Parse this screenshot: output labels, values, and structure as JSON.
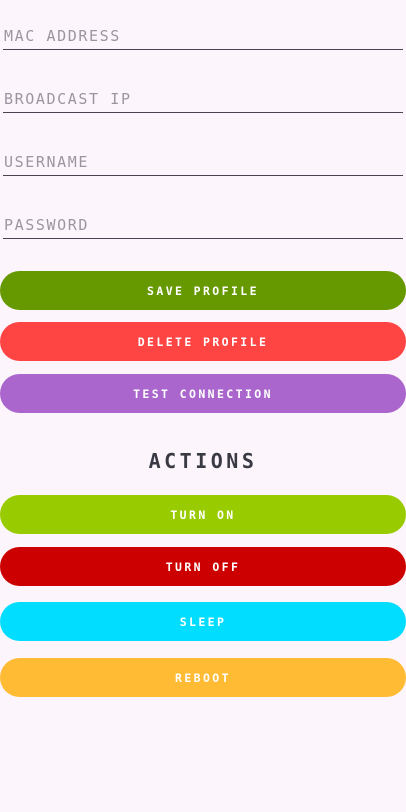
{
  "form": {
    "mac_address": {
      "value": "",
      "placeholder": "MAC ADDRESS"
    },
    "broadcast_ip": {
      "value": "",
      "placeholder": "BROADCAST IP"
    },
    "username": {
      "value": "",
      "placeholder": "USERNAME"
    },
    "password": {
      "value": "",
      "placeholder": "PASSWORD"
    }
  },
  "profile_buttons": {
    "save": {
      "label": "SAVE PROFILE",
      "color": "#669900"
    },
    "delete": {
      "label": "DELETE PROFILE",
      "color": "#FF4444"
    },
    "test": {
      "label": "TEST CONNECTION",
      "color": "#AA66CC"
    }
  },
  "actions": {
    "title": "ACTIONS",
    "turn_on": {
      "label": "TURN ON",
      "color": "#99CC00"
    },
    "turn_off": {
      "label": "TURN OFF",
      "color": "#CC0000"
    },
    "sleep": {
      "label": "SLEEP",
      "color": "#00DDFF"
    },
    "reboot": {
      "label": "REBOOT",
      "color": "#FFBB33"
    }
  }
}
